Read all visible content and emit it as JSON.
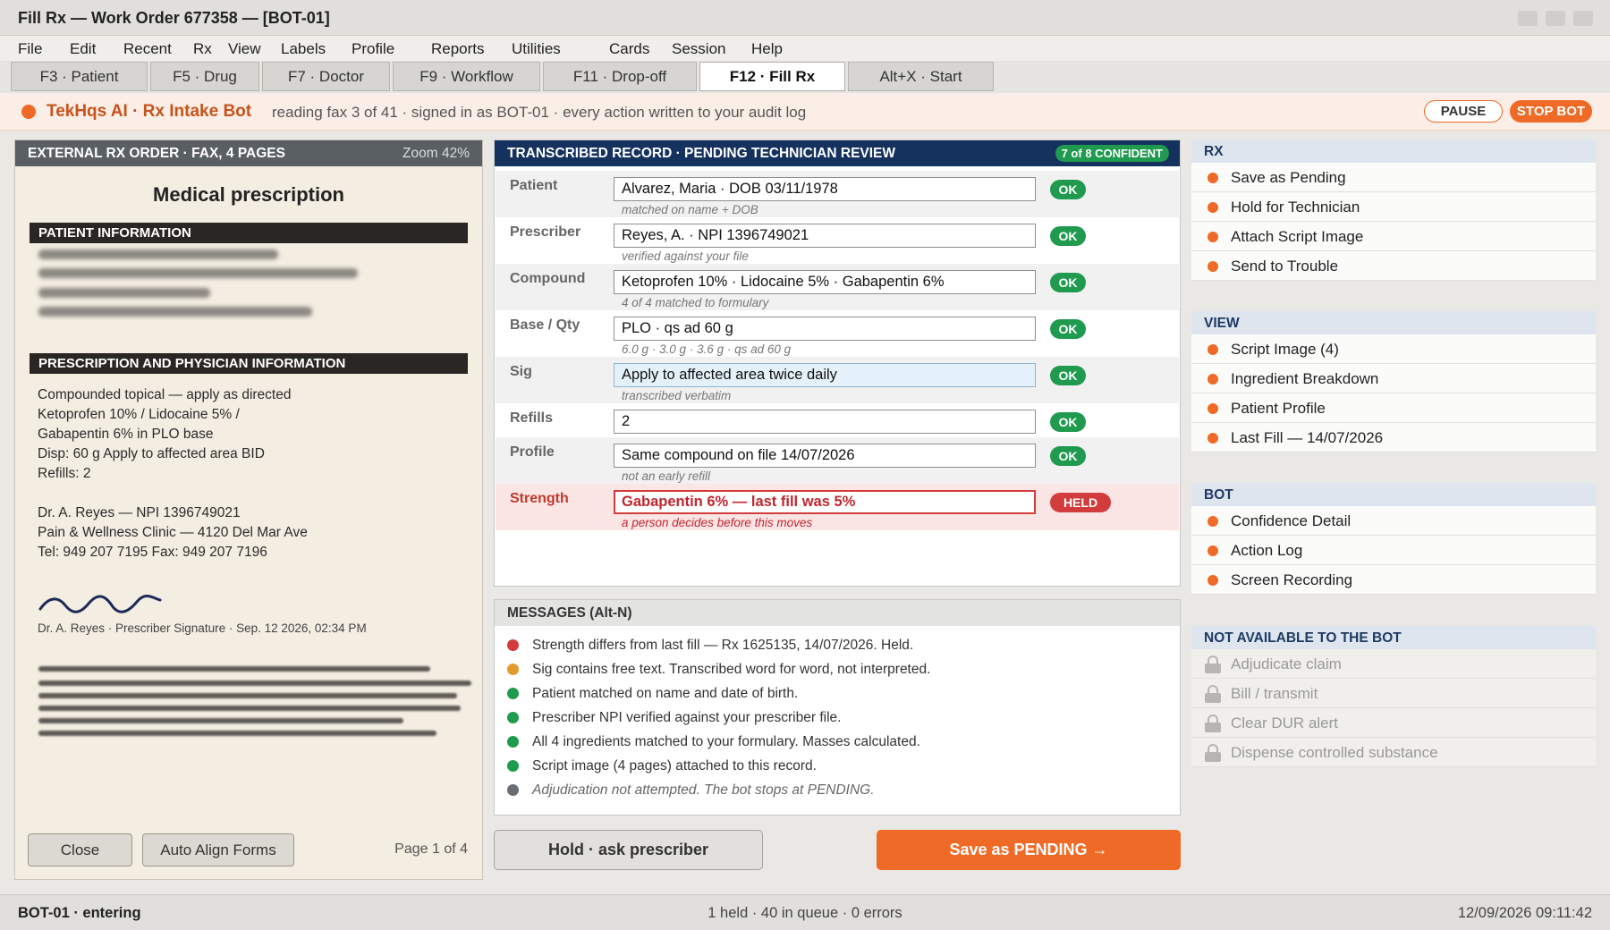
{
  "window": {
    "title": "Fill Rx — Work Order 677358 — [BOT-01]"
  },
  "menu": [
    "File",
    "Edit",
    "Recent",
    "Rx",
    "View",
    "Labels",
    "Profile",
    "Reports",
    "Utilities",
    "Cards",
    "Session",
    "Help"
  ],
  "fkeys": [
    {
      "label": "F3 · Patient",
      "active": false
    },
    {
      "label": "F5 · Drug",
      "active": false
    },
    {
      "label": "F7 · Doctor",
      "active": false
    },
    {
      "label": "F9 · Workflow",
      "active": false
    },
    {
      "label": "F11 · Drop-off",
      "active": false
    },
    {
      "label": "F12 · Fill Rx",
      "active": true
    },
    {
      "label": "Alt+X · Start",
      "active": false
    }
  ],
  "banner": {
    "bot_name": "TekHqs AI · Rx Intake Bot",
    "status": "reading fax 3 of 41 · signed in as BOT-01 · every action written to your audit log",
    "pause_label": "PAUSE",
    "stop_label": "STOP BOT",
    "accent_color": "#ee6a26"
  },
  "fax": {
    "header": "EXTERNAL RX ORDER · FAX, 4 PAGES",
    "zoom": "Zoom 42%",
    "doc_title": "Medical prescription",
    "section1": "PATIENT INFORMATION",
    "section2": "PRESCRIPTION AND PHYSICIAN INFORMATION",
    "rx_lines": [
      "Compounded topical — apply as directed",
      "Ketoprofen 10% / Lidocaine 5% /",
      "Gabapentin 6% in PLO base",
      "Disp: 60 g Apply to affected area BID",
      "Refills: 2"
    ],
    "doctor_lines": [
      "Dr. A. Reyes — NPI 1396749021",
      "Pain & Wellness Clinic — 4120 Del Mar Ave",
      "Tel: 949 207 7195 Fax: 949 207 7196"
    ],
    "signature_caption": "Dr. A. Reyes · Prescriber Signature · Sep. 12 2026, 02:34 PM",
    "close_label": "Close",
    "align_label": "Auto Align Forms",
    "page_label": "Page 1 of 4"
  },
  "record": {
    "header": "TRANSCRIBED RECORD · PENDING TECHNICIAN REVIEW",
    "confidence": "7 of 8 CONFIDENT",
    "rows": [
      {
        "label": "Patient",
        "value": "Alvarez, Maria · DOB 03/11/1978",
        "note": "matched on name + DOB",
        "status": "OK"
      },
      {
        "label": "Prescriber",
        "value": "Reyes, A. · NPI 1396749021",
        "note": "verified against your file",
        "status": "OK"
      },
      {
        "label": "Compound",
        "value": "Ketoprofen 10% · Lidocaine 5% · Gabapentin 6%",
        "note": "4 of 4 matched to formulary",
        "status": "OK"
      },
      {
        "label": "Base / Qty",
        "value": "PLO · qs ad 60 g",
        "note": "6.0 g · 3.0 g · 3.6 g · qs ad 60 g",
        "status": "OK"
      },
      {
        "label": "Sig",
        "value": "Apply to affected area twice daily",
        "note": "transcribed verbatim",
        "status": "OK"
      },
      {
        "label": "Refills",
        "value": "2",
        "note": "",
        "status": "OK"
      },
      {
        "label": "Profile",
        "value": "Same compound on file 14/07/2026",
        "note": "not an early refill",
        "status": "OK"
      },
      {
        "label": "Strength",
        "value": "Gabapentin 6% — last fill was 5%",
        "note": "a person decides before this moves",
        "status": "HELD"
      }
    ]
  },
  "messages": {
    "header": "MESSAGES (Alt-N)",
    "items": [
      {
        "text": "Strength differs from last fill — Rx 1625135, 14/07/2026. Held.",
        "color": "#d23c3c"
      },
      {
        "text": "Sig contains free text. Transcribed word for word, not interpreted.",
        "color": "#e39a2e"
      },
      {
        "text": "Patient matched on name and date of birth.",
        "color": "#1f9a4f"
      },
      {
        "text": "Prescriber NPI verified against your prescriber file.",
        "color": "#1f9a4f"
      },
      {
        "text": "All 4 ingredients matched to your formulary. Masses calculated.",
        "color": "#1f9a4f"
      },
      {
        "text": "Script image (4 pages) attached to this record.",
        "color": "#1f9a4f"
      },
      {
        "text": "Adjudication not attempted. The bot stops at PENDING.",
        "color": "#6a6d73"
      }
    ]
  },
  "actions": {
    "hold_label": "Hold · ask prescriber",
    "save_label": "Save as PENDING →"
  },
  "sidebar": {
    "rx": {
      "title": "RX",
      "items": [
        "Save as Pending",
        "Hold for Technician",
        "Attach Script Image",
        "Send to Trouble"
      ]
    },
    "view": {
      "title": "VIEW",
      "items": [
        "Script Image (4)",
        "Ingredient Breakdown",
        "Patient Profile",
        "Last Fill — 14/07/2026"
      ]
    },
    "bot": {
      "title": "BOT",
      "items": [
        "Confidence Detail",
        "Action Log",
        "Screen Recording"
      ]
    },
    "locked": {
      "title": "NOT AVAILABLE TO THE BOT",
      "items": [
        "Adjudicate claim",
        "Bill / transmit",
        "Clear DUR alert",
        "Dispense controlled substance"
      ]
    }
  },
  "statusbar": {
    "left": "BOT-01 · entering",
    "center": "1 held · 40 in queue · 0 errors",
    "right": "12/09/2026 09:11:42"
  }
}
